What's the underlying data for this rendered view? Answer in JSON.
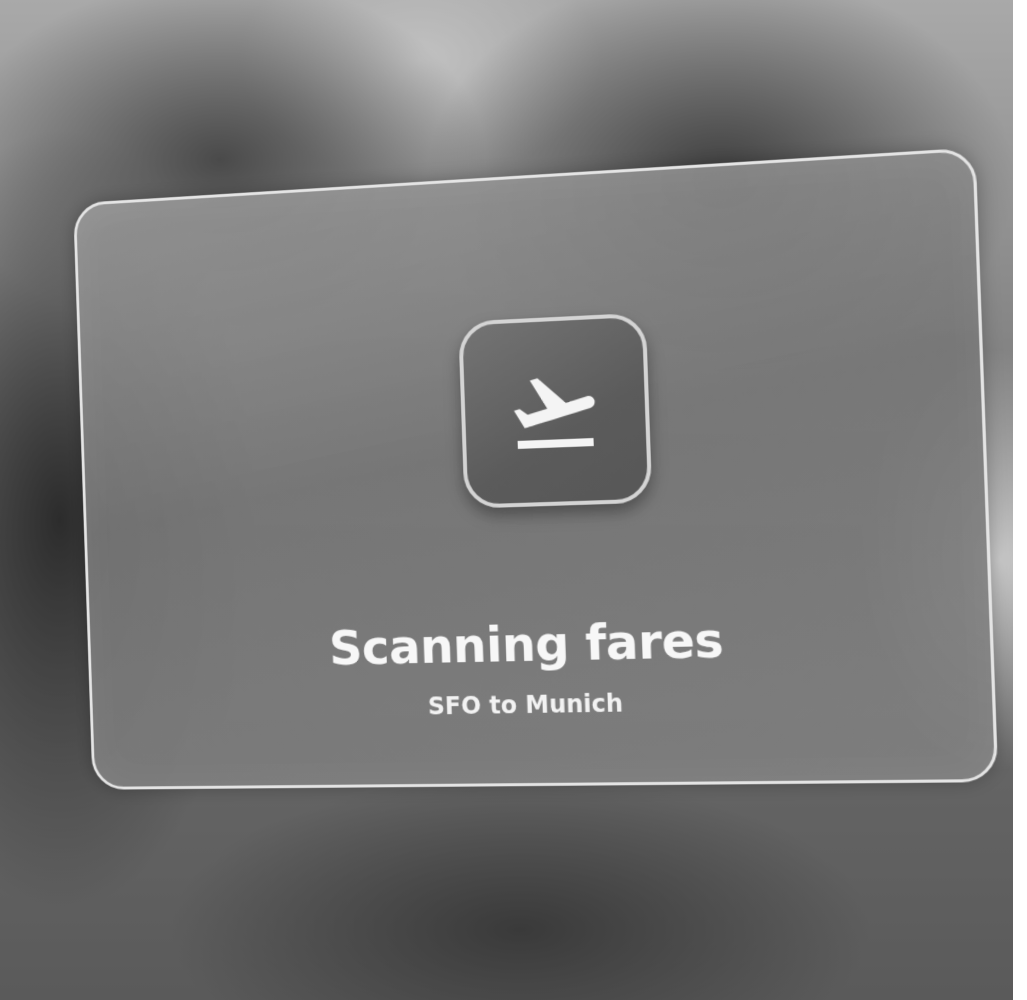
{
  "status_card": {
    "icon": "flight-takeoff-icon",
    "title": "Scanning fares",
    "subtitle": "SFO to Munich"
  }
}
